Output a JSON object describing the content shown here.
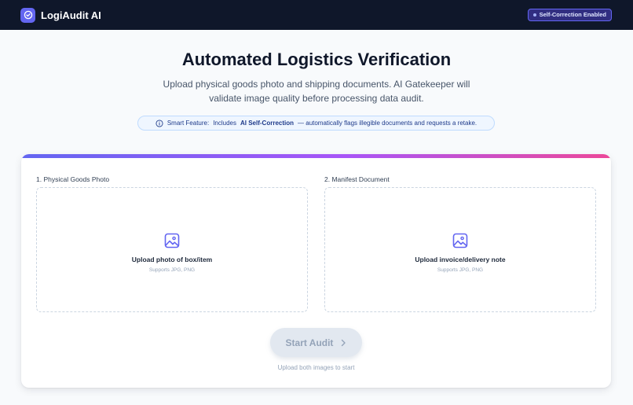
{
  "app": {
    "name": "LogiAudit AI",
    "status_badge": "Self-Correction Enabled"
  },
  "hero": {
    "title": "Automated Logistics Verification",
    "subtitle": "Upload physical goods photo and shipping documents. AI Gatekeeper will validate image quality before processing data audit."
  },
  "feature": {
    "prefix": "Smart Feature:",
    "text_before": "Includes",
    "highlight": "AI Self-Correction",
    "text_after": "— automatically flags illegible documents and requests a retake."
  },
  "uploads": {
    "goods": {
      "label": "1. Physical Goods Photo",
      "title": "Upload photo of box/item",
      "hint": "Supports JPG, PNG"
    },
    "manifest": {
      "label": "2. Manifest Document",
      "title": "Upload invoice/delivery note",
      "hint": "Supports JPG, PNG"
    }
  },
  "action": {
    "button_label": "Start Audit",
    "helper": "Upload both images to start"
  },
  "colors": {
    "topbar": "#0f172a",
    "accent": "#6366f1",
    "gradient_end": "#ec4899"
  },
  "icons": {
    "logo": "check-circle-icon",
    "upload": "image-icon",
    "info": "info-icon",
    "button": "chevron-right-icon"
  }
}
